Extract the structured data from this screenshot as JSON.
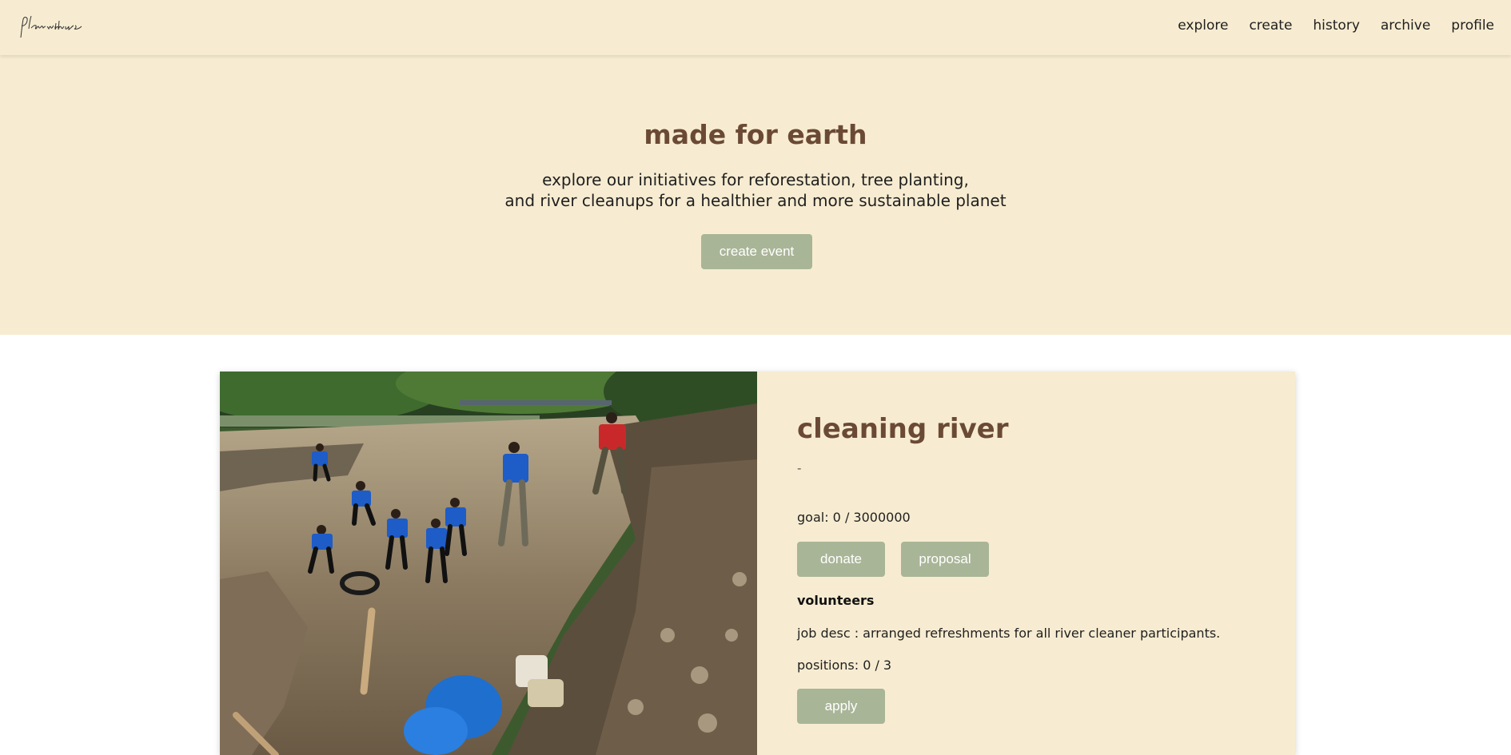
{
  "header": {
    "logo_text": "plan with us",
    "nav": [
      {
        "label": "explore"
      },
      {
        "label": "create"
      },
      {
        "label": "history"
      },
      {
        "label": "archive"
      },
      {
        "label": "profile"
      }
    ]
  },
  "hero": {
    "title": "made for earth",
    "description_line1": "explore our initiatives for reforestation, tree planting,",
    "description_line2": "and river cleanups for a healthier and more sustainable planet",
    "create_button": "create event"
  },
  "event": {
    "title": "cleaning river",
    "subtitle": "-",
    "goal": "goal: 0 / 3000000",
    "donate_button": "donate",
    "proposal_button": "proposal",
    "volunteers_heading": "volunteers",
    "job_desc": "job desc : arranged refreshments for all river cleaner participants.",
    "positions": "positions: 0 / 3",
    "apply_button": "apply"
  },
  "colors": {
    "cream": "#f7ecd1",
    "brown": "#6b4a35",
    "sage_button": "#a9b597"
  }
}
